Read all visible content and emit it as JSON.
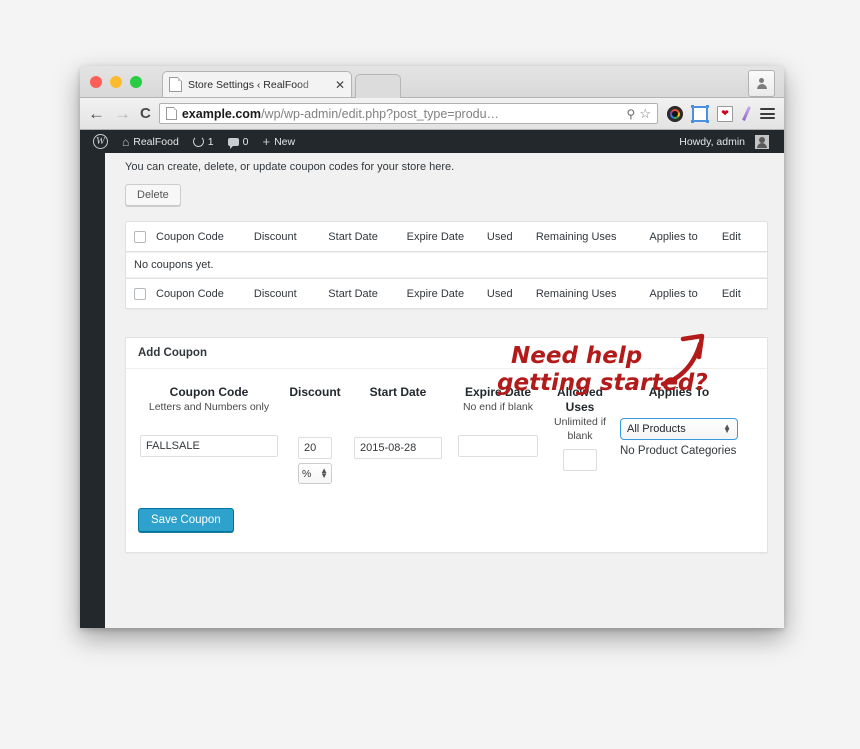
{
  "browser": {
    "tab": {
      "title": "Store Settings ‹ RealFood",
      "close_label": "✕",
      "favicon": "page-icon"
    },
    "nav": {
      "back": "←",
      "forward": "→",
      "reload": "C"
    },
    "omnibox": {
      "host": "example.com",
      "path": "/wp/wp-admin/edit.php?post_type=produ…",
      "search_icon": "search-icon",
      "bookmark_icon": "star-icon"
    },
    "extensions": [
      {
        "name": "chrome-color-wheel-icon"
      },
      {
        "name": "screenshot-crop-icon"
      },
      {
        "name": "heart-bookmark-icon"
      },
      {
        "name": "purple-pen-icon"
      },
      {
        "name": "hamburger-menu-icon"
      }
    ],
    "profile_icon": "person-icon"
  },
  "adminbar": {
    "wp_logo": "W",
    "site_name": "RealFood",
    "updates_count": "1",
    "comments_count": "0",
    "new_label": "New",
    "howdy": "Howdy, admin"
  },
  "page": {
    "intro": "You can create, delete, or update coupon codes for your store here.",
    "delete_button": "Delete"
  },
  "table": {
    "columns": [
      "Coupon Code",
      "Discount",
      "Start Date",
      "Expire Date",
      "Used",
      "Remaining Uses",
      "Applies to",
      "Edit"
    ],
    "empty_message": "No coupons yet."
  },
  "add_coupon": {
    "panel_title": "Add Coupon",
    "fields": [
      {
        "label": "Coupon Code",
        "hint": "Letters and Numbers only",
        "value": "FALLSALE"
      },
      {
        "label": "Discount",
        "hint": "",
        "value": "20",
        "unit": "%"
      },
      {
        "label": "Start Date",
        "hint": "",
        "value": "2015-08-28"
      },
      {
        "label": "Expire Date",
        "hint": "No end if blank",
        "value": ""
      },
      {
        "label": "Allowed Uses",
        "hint": "Unlimited if blank",
        "value": ""
      },
      {
        "label": "Applies To",
        "hint": "",
        "value": "All Products",
        "note": "No Product Categories"
      }
    ],
    "save_button": "Save Coupon"
  },
  "annotation": {
    "line1": "Need help",
    "line2": "getting started?",
    "color": "#b31b1b"
  }
}
